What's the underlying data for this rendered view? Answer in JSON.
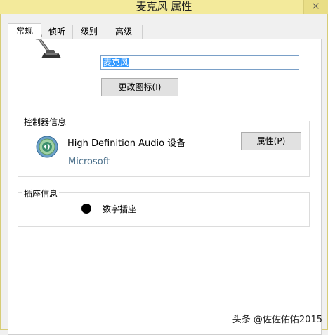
{
  "window": {
    "title": "麦克风 属性"
  },
  "tabs": [
    {
      "label": "常规"
    },
    {
      "label": "侦听"
    },
    {
      "label": "级别"
    },
    {
      "label": "高级"
    }
  ],
  "general": {
    "name_value": "麦克风",
    "change_icon_label": "更改图标(I)"
  },
  "controller": {
    "group_label": "控制器信息",
    "device_name": "High Definition Audio 设备",
    "vendor": "Microsoft",
    "properties_label": "属性(P)"
  },
  "jack": {
    "group_label": "插座信息",
    "item_label": "数字插座"
  },
  "watermark": "头条 @佐佐佑佑2015"
}
